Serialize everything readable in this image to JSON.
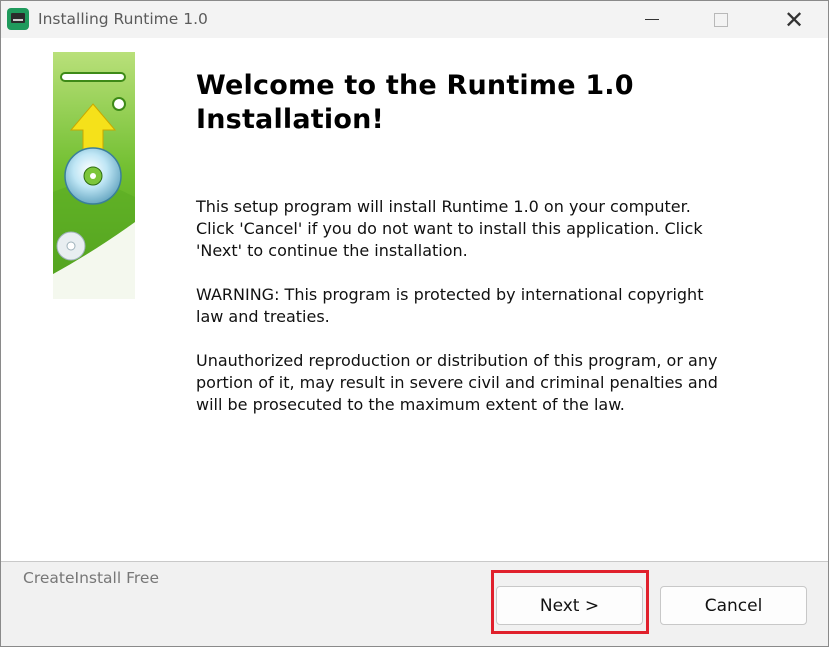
{
  "window": {
    "title": "Installing Runtime 1.0",
    "app_icon": "installer-icon",
    "controls": {
      "minimize": "minimize-icon",
      "maximize": "maximize-icon",
      "close": "✕"
    }
  },
  "content": {
    "heading_line1": "Welcome to the Runtime 1.0",
    "heading_line2": "Installation!",
    "paragraph1": "This setup program will install Runtime 1.0 on your computer.\nClick 'Cancel' if you do not want to install this application. Click\n'Next' to continue the installation.",
    "paragraph2": "WARNING: This program is protected by international copyright\nlaw and treaties.",
    "paragraph3": "Unauthorized reproduction or distribution of this program, or any\nportion of it, may result in severe civil and criminal penalties and\nwill be prosecuted to the maximum extent of the law."
  },
  "side_banner": {
    "icon": "install-disc-banner",
    "accent": "#7cc63a",
    "arrow_color": "#f5e11a"
  },
  "footer": {
    "brand": "CreateInstall Free",
    "next_label": "Next >",
    "cancel_label": "Cancel",
    "highlight_color": "#e0202c"
  }
}
